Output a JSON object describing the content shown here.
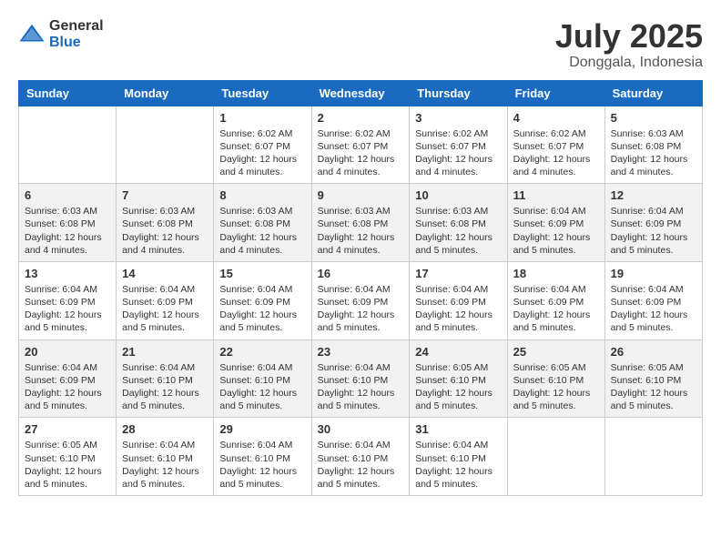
{
  "header": {
    "logo_general": "General",
    "logo_blue": "Blue",
    "title": "July 2025",
    "subtitle": "Donggala, Indonesia"
  },
  "calendar": {
    "columns": [
      "Sunday",
      "Monday",
      "Tuesday",
      "Wednesday",
      "Thursday",
      "Friday",
      "Saturday"
    ],
    "weeks": [
      [
        {
          "day": "",
          "info": ""
        },
        {
          "day": "",
          "info": ""
        },
        {
          "day": "1",
          "info": "Sunrise: 6:02 AM\nSunset: 6:07 PM\nDaylight: 12 hours\nand 4 minutes."
        },
        {
          "day": "2",
          "info": "Sunrise: 6:02 AM\nSunset: 6:07 PM\nDaylight: 12 hours\nand 4 minutes."
        },
        {
          "day": "3",
          "info": "Sunrise: 6:02 AM\nSunset: 6:07 PM\nDaylight: 12 hours\nand 4 minutes."
        },
        {
          "day": "4",
          "info": "Sunrise: 6:02 AM\nSunset: 6:07 PM\nDaylight: 12 hours\nand 4 minutes."
        },
        {
          "day": "5",
          "info": "Sunrise: 6:03 AM\nSunset: 6:08 PM\nDaylight: 12 hours\nand 4 minutes."
        }
      ],
      [
        {
          "day": "6",
          "info": "Sunrise: 6:03 AM\nSunset: 6:08 PM\nDaylight: 12 hours\nand 4 minutes."
        },
        {
          "day": "7",
          "info": "Sunrise: 6:03 AM\nSunset: 6:08 PM\nDaylight: 12 hours\nand 4 minutes."
        },
        {
          "day": "8",
          "info": "Sunrise: 6:03 AM\nSunset: 6:08 PM\nDaylight: 12 hours\nand 4 minutes."
        },
        {
          "day": "9",
          "info": "Sunrise: 6:03 AM\nSunset: 6:08 PM\nDaylight: 12 hours\nand 4 minutes."
        },
        {
          "day": "10",
          "info": "Sunrise: 6:03 AM\nSunset: 6:08 PM\nDaylight: 12 hours\nand 5 minutes."
        },
        {
          "day": "11",
          "info": "Sunrise: 6:04 AM\nSunset: 6:09 PM\nDaylight: 12 hours\nand 5 minutes."
        },
        {
          "day": "12",
          "info": "Sunrise: 6:04 AM\nSunset: 6:09 PM\nDaylight: 12 hours\nand 5 minutes."
        }
      ],
      [
        {
          "day": "13",
          "info": "Sunrise: 6:04 AM\nSunset: 6:09 PM\nDaylight: 12 hours\nand 5 minutes."
        },
        {
          "day": "14",
          "info": "Sunrise: 6:04 AM\nSunset: 6:09 PM\nDaylight: 12 hours\nand 5 minutes."
        },
        {
          "day": "15",
          "info": "Sunrise: 6:04 AM\nSunset: 6:09 PM\nDaylight: 12 hours\nand 5 minutes."
        },
        {
          "day": "16",
          "info": "Sunrise: 6:04 AM\nSunset: 6:09 PM\nDaylight: 12 hours\nand 5 minutes."
        },
        {
          "day": "17",
          "info": "Sunrise: 6:04 AM\nSunset: 6:09 PM\nDaylight: 12 hours\nand 5 minutes."
        },
        {
          "day": "18",
          "info": "Sunrise: 6:04 AM\nSunset: 6:09 PM\nDaylight: 12 hours\nand 5 minutes."
        },
        {
          "day": "19",
          "info": "Sunrise: 6:04 AM\nSunset: 6:09 PM\nDaylight: 12 hours\nand 5 minutes."
        }
      ],
      [
        {
          "day": "20",
          "info": "Sunrise: 6:04 AM\nSunset: 6:09 PM\nDaylight: 12 hours\nand 5 minutes."
        },
        {
          "day": "21",
          "info": "Sunrise: 6:04 AM\nSunset: 6:10 PM\nDaylight: 12 hours\nand 5 minutes."
        },
        {
          "day": "22",
          "info": "Sunrise: 6:04 AM\nSunset: 6:10 PM\nDaylight: 12 hours\nand 5 minutes."
        },
        {
          "day": "23",
          "info": "Sunrise: 6:04 AM\nSunset: 6:10 PM\nDaylight: 12 hours\nand 5 minutes."
        },
        {
          "day": "24",
          "info": "Sunrise: 6:05 AM\nSunset: 6:10 PM\nDaylight: 12 hours\nand 5 minutes."
        },
        {
          "day": "25",
          "info": "Sunrise: 6:05 AM\nSunset: 6:10 PM\nDaylight: 12 hours\nand 5 minutes."
        },
        {
          "day": "26",
          "info": "Sunrise: 6:05 AM\nSunset: 6:10 PM\nDaylight: 12 hours\nand 5 minutes."
        }
      ],
      [
        {
          "day": "27",
          "info": "Sunrise: 6:05 AM\nSunset: 6:10 PM\nDaylight: 12 hours\nand 5 minutes."
        },
        {
          "day": "28",
          "info": "Sunrise: 6:04 AM\nSunset: 6:10 PM\nDaylight: 12 hours\nand 5 minutes."
        },
        {
          "day": "29",
          "info": "Sunrise: 6:04 AM\nSunset: 6:10 PM\nDaylight: 12 hours\nand 5 minutes."
        },
        {
          "day": "30",
          "info": "Sunrise: 6:04 AM\nSunset: 6:10 PM\nDaylight: 12 hours\nand 5 minutes."
        },
        {
          "day": "31",
          "info": "Sunrise: 6:04 AM\nSunset: 6:10 PM\nDaylight: 12 hours\nand 5 minutes."
        },
        {
          "day": "",
          "info": ""
        },
        {
          "day": "",
          "info": ""
        }
      ]
    ]
  }
}
